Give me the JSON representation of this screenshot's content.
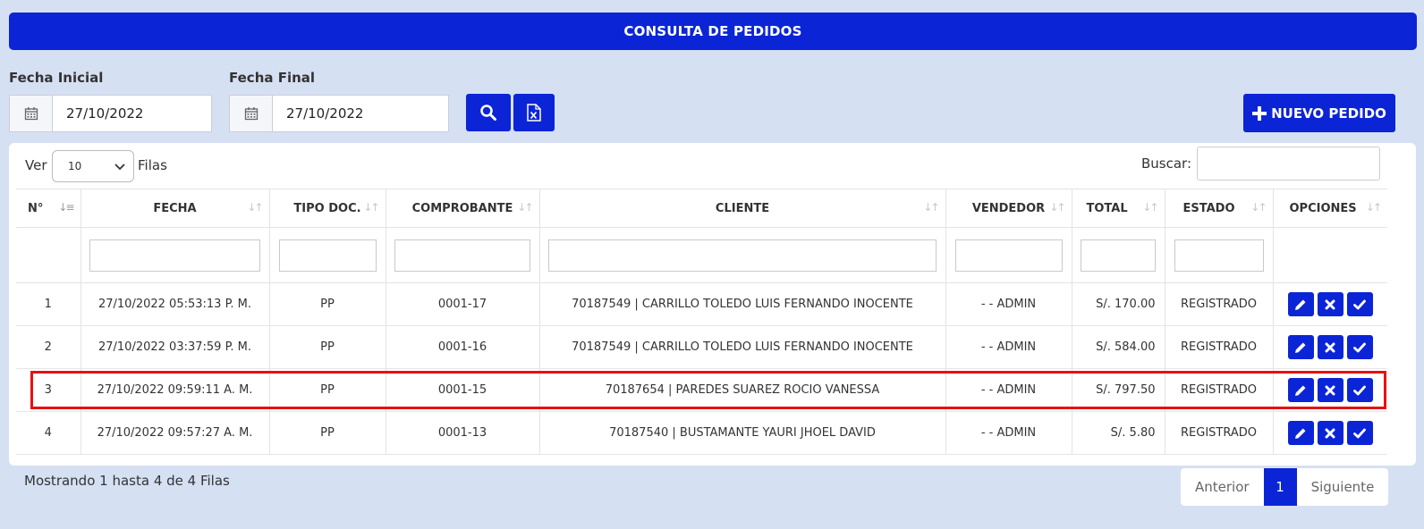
{
  "header": {
    "title": "CONSULTA DE PEDIDOS"
  },
  "filters": {
    "start_label": "Fecha Inicial",
    "start_value": "27/10/2022",
    "end_label": "Fecha Final",
    "end_value": "27/10/2022"
  },
  "actions": {
    "new_order_label": "NUEVO PEDIDO"
  },
  "table_controls": {
    "show_label": "Ver",
    "page_size": "10",
    "rows_label": "Filas",
    "search_label": "Buscar:"
  },
  "columns": [
    "N°",
    "FECHA",
    "TIPO DOC.",
    "COMPROBANTE",
    "CLIENTE",
    "VENDEDOR",
    "TOTAL",
    "ESTADO",
    "OPCIONES"
  ],
  "rows": [
    {
      "n": "1",
      "fecha": "27/10/2022 05:53:13 P. M.",
      "tipo": "PP",
      "comprobante": "0001-17",
      "cliente": "70187549 | CARRILLO TOLEDO LUIS FERNANDO INOCENTE",
      "vendedor": "- - ADMIN",
      "total": "S/. 170.00",
      "estado": "REGISTRADO"
    },
    {
      "n": "2",
      "fecha": "27/10/2022 03:37:59 P. M.",
      "tipo": "PP",
      "comprobante": "0001-16",
      "cliente": "70187549 | CARRILLO TOLEDO LUIS FERNANDO INOCENTE",
      "vendedor": "- - ADMIN",
      "total": "S/. 584.00",
      "estado": "REGISTRADO"
    },
    {
      "n": "3",
      "fecha": "27/10/2022 09:59:11 A. M.",
      "tipo": "PP",
      "comprobante": "0001-15",
      "cliente": "70187654 | PAREDES SUAREZ ROCIO VANESSA",
      "vendedor": "- - ADMIN",
      "total": "S/. 797.50",
      "estado": "REGISTRADO"
    },
    {
      "n": "4",
      "fecha": "27/10/2022 09:57:27 A. M.",
      "tipo": "PP",
      "comprobante": "0001-13",
      "cliente": "70187540 | BUSTAMANTE YAURI JHOEL DAVID",
      "vendedor": "- - ADMIN",
      "total": "S/. 5.80",
      "estado": "REGISTRADO"
    }
  ],
  "footer": {
    "info": "Mostrando 1 hasta 4 de 4 Filas",
    "prev": "Anterior",
    "current": "1",
    "next": "Siguiente"
  },
  "colors": {
    "primary": "#0b25d6",
    "background": "#d6e0f3",
    "highlight": "#e81111"
  }
}
